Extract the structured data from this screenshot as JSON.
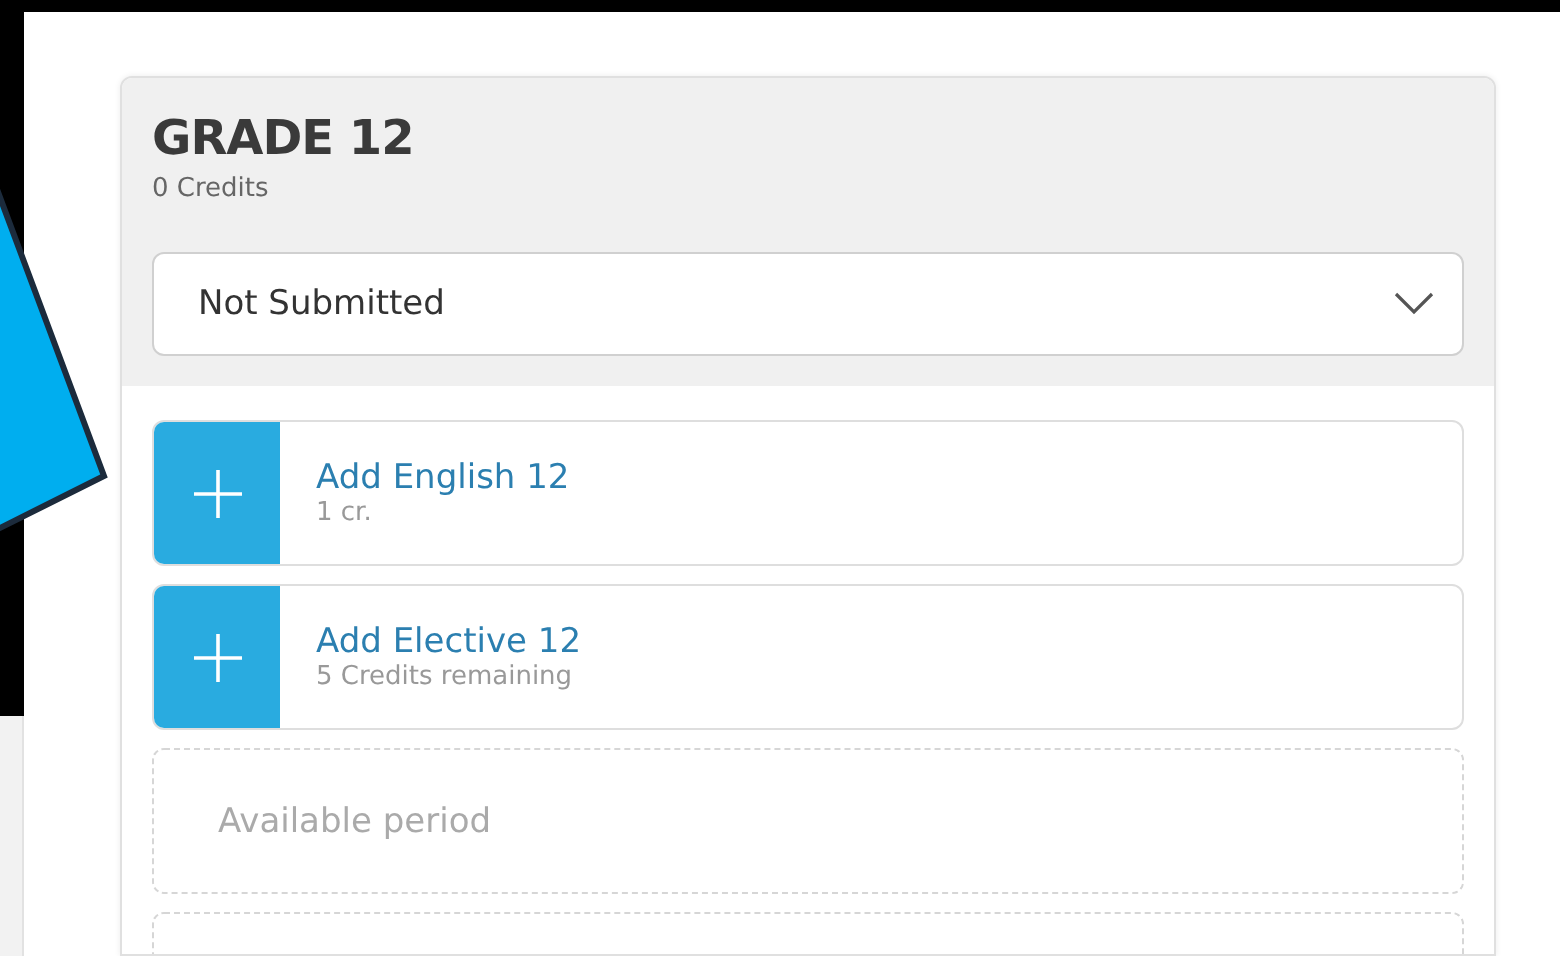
{
  "card": {
    "title": "GRADE 12",
    "credits": "0 Credits",
    "status_select": {
      "value": "Not Submitted"
    }
  },
  "slots": [
    {
      "kind": "add",
      "title": "Add English 12",
      "detail": "1 cr."
    },
    {
      "kind": "add",
      "title": "Add Elective 12",
      "detail": "5 Credits remaining"
    },
    {
      "kind": "empty",
      "label": "Available period"
    },
    {
      "kind": "empty"
    }
  ]
}
